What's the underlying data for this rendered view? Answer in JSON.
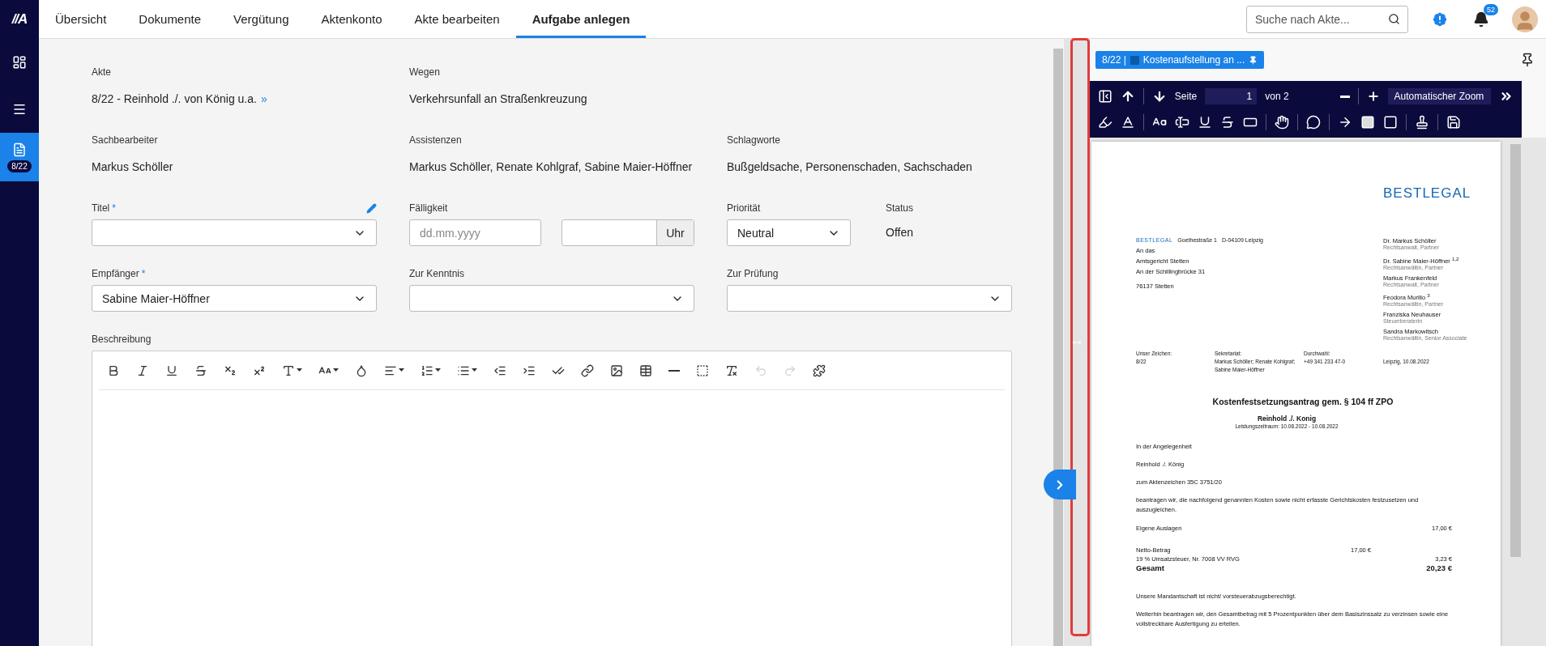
{
  "sidebar": {
    "logo": "//A",
    "items": [
      {
        "kind": "dashboard",
        "selected": false
      },
      {
        "kind": "menu",
        "selected": false
      },
      {
        "kind": "file",
        "selected": true,
        "badge": "8/22"
      }
    ]
  },
  "header": {
    "tabs": [
      {
        "label": "Übersicht",
        "selected": false
      },
      {
        "label": "Dokumente",
        "selected": false
      },
      {
        "label": "Vergütung",
        "selected": false
      },
      {
        "label": "Aktenkonto",
        "selected": false
      },
      {
        "label": "Akte bearbeiten",
        "selected": false
      },
      {
        "label": "Aufgabe anlegen",
        "selected": true
      }
    ],
    "search": {
      "placeholder": "Suche nach Akte..."
    },
    "notifications": "52"
  },
  "case_info": [
    {
      "label": "Akte",
      "value": "8/22 - Reinhold ./. von König u.a.",
      "link": "»"
    },
    {
      "label": "Wegen",
      "value": "Verkehrsunfall an Straßenkreuzung"
    }
  ],
  "people": [
    {
      "label": "Sachbearbeiter",
      "value": "Markus Schöller"
    },
    {
      "label": "Assistenzen",
      "value": "Markus Schöller, Renate Kohlgraf, Sabine Maier-Höffner"
    },
    {
      "label": "Schlagworte",
      "value": "Bußgeldsache, Personenschaden, Sachschaden"
    }
  ],
  "task": {
    "title": {
      "label": "Titel",
      "required_mark": "*"
    },
    "due": {
      "label": "Fälligkeit",
      "placeholder": "dd.mm.yyyy",
      "time_addon": "Uhr"
    },
    "priority": {
      "label": "Priorität",
      "value": "Neutral"
    },
    "status": {
      "label": "Status",
      "value": "Offen"
    },
    "recipient": {
      "label": "Empfänger",
      "required_mark": "*",
      "value": "Sabine Maier-Höffner"
    },
    "cc": {
      "label": "Zur Kenntnis"
    },
    "review": {
      "label": "Zur Prüfung"
    }
  },
  "description": {
    "label": "Beschreibung",
    "toolbar": [
      {
        "kind": "bold",
        "disabled": false
      },
      {
        "kind": "italic",
        "disabled": false
      },
      {
        "kind": "underline",
        "disabled": false
      },
      {
        "kind": "strikethrough",
        "disabled": false
      },
      {
        "kind": "subscript",
        "disabled": false
      },
      {
        "kind": "superscript",
        "disabled": false
      },
      {
        "kind": "font-color",
        "disabled": false,
        "dropdown": true
      },
      {
        "kind": "font-size",
        "disabled": false,
        "dropdown": true
      },
      {
        "kind": "fill",
        "disabled": false
      },
      {
        "kind": "align",
        "disabled": false,
        "dropdown": true
      },
      {
        "kind": "ordered-list",
        "disabled": false,
        "dropdown": true
      },
      {
        "kind": "bullet-list",
        "disabled": false,
        "dropdown": true
      },
      {
        "kind": "outdent",
        "disabled": false
      },
      {
        "kind": "indent",
        "disabled": false
      },
      {
        "kind": "check",
        "disabled": false
      },
      {
        "kind": "link",
        "disabled": false
      },
      {
        "kind": "image",
        "disabled": false
      },
      {
        "kind": "table",
        "disabled": false
      },
      {
        "kind": "rule",
        "disabled": false
      },
      {
        "kind": "select-all",
        "disabled": false
      },
      {
        "kind": "clear-format",
        "disabled": false
      },
      {
        "kind": "undo",
        "disabled": true
      },
      {
        "kind": "redo",
        "disabled": true
      },
      {
        "kind": "plugin",
        "disabled": false
      }
    ]
  },
  "viewer": {
    "tab": {
      "prefix": "8/22 |",
      "label": "Kostenaufstellung an ..."
    },
    "toolbar": {
      "page_label": "Seite",
      "page": "1",
      "page_total": "von 2",
      "zoom": "Automatischer Zoom"
    },
    "tools": [
      {
        "kind": "highlight"
      },
      {
        "kind": "text-color"
      },
      {
        "kind": "font"
      },
      {
        "kind": "text-box"
      },
      {
        "kind": "underline"
      },
      {
        "kind": "strikethrough"
      },
      {
        "kind": "redact"
      },
      {
        "kind": "hand"
      },
      {
        "kind": "comment"
      },
      {
        "kind": "arrow"
      },
      {
        "kind": "filled-square"
      },
      {
        "kind": "square"
      },
      {
        "kind": "stamp"
      },
      {
        "kind": "save"
      }
    ],
    "document": {
      "logo": "BESTLEGAL",
      "sender": [
        "BESTLEGAL",
        "Goethestraße 1",
        "D-04109 Leipzig"
      ],
      "recipient": [
        "An das",
        "Amtsgericht Stetten",
        "An der Schillingbrücke 31",
        "76137 Stetten"
      ],
      "team": [
        {
          "name": "Dr. Markus Schöller",
          "role": "Rechtsanwalt, Partner"
        },
        {
          "name": "Dr. Sabine Maier-Höffner $^{1,2}$",
          "role": "Rechtsanwältin, Partner"
        },
        {
          "name": "Markus Frankenfeld",
          "role": "Rechtsanwalt, Partner"
        },
        {
          "name": "Feodora Murillo $^{3}$",
          "role": "Rechtsanwältin, Partner"
        },
        {
          "name": "Franziska Neuhauser",
          "role": "Steuerberaterin"
        },
        {
          "name": "Sandra Markowitsch",
          "role": "Rechtsanwältin, Senior Associate"
        }
      ],
      "reference": [
        {
          "label": "Unser Zeichen:",
          "value": "8/22"
        },
        {
          "label": "Sekretariat:",
          "value": "Markus Schöller; Renate Kohlgraf; Sabine Maier-Höffner"
        },
        {
          "label": "Durchwahl:",
          "value": "+49 341 233 47-0"
        }
      ],
      "date": "Leipzig, 10.08.2022",
      "title": "Kostenfestsetzungsantrag gem. § 104 ff ZPO",
      "parties": "Reinhold ./. Konig",
      "period": "Leistungszeitraum: 10.08.2022 - 10.08.2022",
      "intro": [
        "In der Angelegenheit",
        "Reinhold ./. König",
        "zum Aktenzeichen 35C 3751/20",
        "beantragen wir, die nachfolgend genannten Kosten sowie nicht erfasste Gerichtskosten festzusetzen und auszugleichen."
      ],
      "costs": [
        {
          "kind": "item",
          "label": "Eigene Auslagen",
          "amount": "17,00 €"
        },
        {
          "kind": "subtotal",
          "label": "Netto-Betrag",
          "amount": "17,00 €"
        },
        {
          "kind": "tax",
          "label": "19 % Umsatzsteuer, Nr. 7008 VV RVG",
          "amount": "3,23 €"
        },
        {
          "kind": "total",
          "label": "Gesamt",
          "amount": "20,23 €"
        }
      ],
      "closing": [
        "Unsere Mandantschaft ist nicht/ vorsteuerabzugsberechtigt.",
        "Weiterhin beantragen wir, den Gesamtbetrag mit 5 Prozentpunkten über dem Basiszinssatz zu verzinsen sowie eine vollstreckbare Ausfertigung zu erteilen."
      ]
    }
  }
}
